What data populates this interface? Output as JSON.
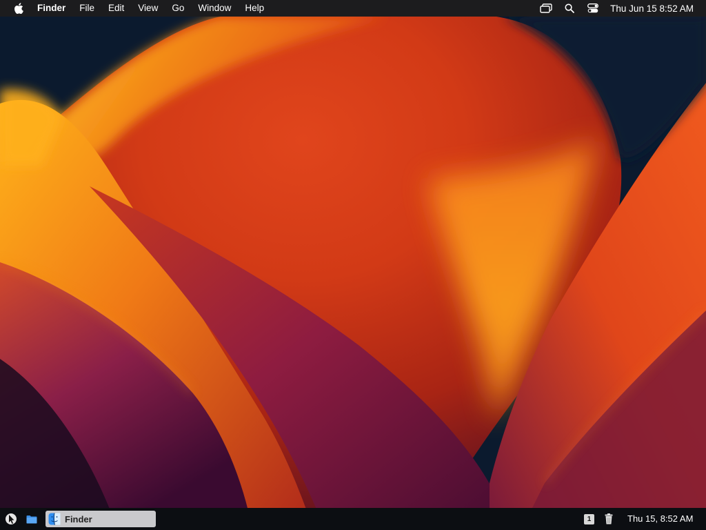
{
  "menubar": {
    "app_name": "Finder",
    "menus": [
      "File",
      "Edit",
      "View",
      "Go",
      "Window",
      "Help"
    ],
    "status_icons": [
      "screen-mirroring-icon",
      "spotlight-search-icon",
      "control-center-icon"
    ],
    "clock": "Thu Jun 15  8:52 AM"
  },
  "taskbar": {
    "launcher_icon": "launcher-icon",
    "files_icon": "folder-icon",
    "window_button": {
      "label": "Finder",
      "icon": "finder-icon"
    },
    "workspace_number": "1",
    "trash_icon": "trash-icon",
    "clock": "Thu 15, 8:52 AM"
  },
  "colors": {
    "menubar_bg": "#1c1c1e",
    "taskbar_bg": "#0c0e12",
    "wallpaper_dark": "#0b1a2e",
    "wallpaper_orange": "#f28a1a",
    "wallpaper_red": "#c8321a",
    "wallpaper_purple": "#6a1a4a"
  }
}
